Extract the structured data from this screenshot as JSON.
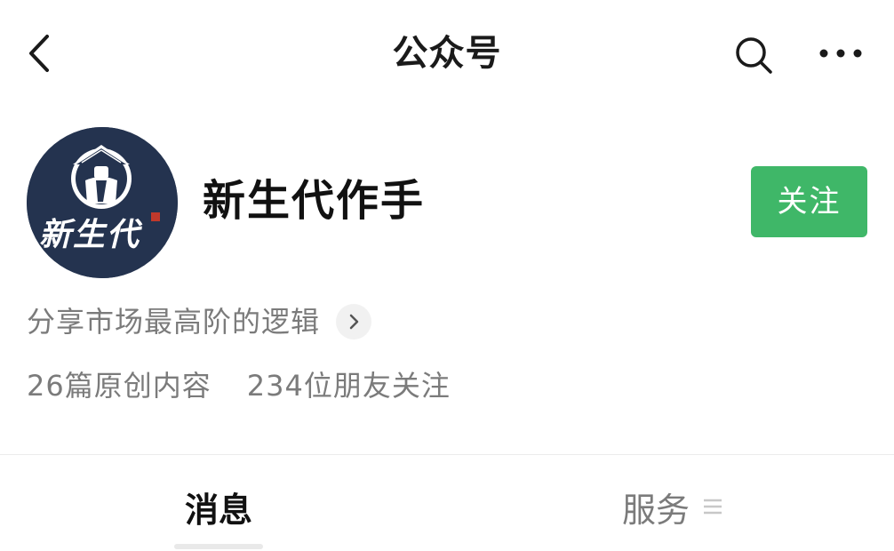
{
  "navbar": {
    "title": "公众号",
    "back_icon": "chevron-left-icon",
    "search_icon": "search-icon",
    "more_icon": "more-dots-icon"
  },
  "profile": {
    "name": "新生代作手",
    "avatar_text": "新生代",
    "follow_label": "关注",
    "intro": "分享市场最高阶的逻辑",
    "stats": {
      "articles": "26篇原创内容",
      "followers": "234位朋友关注"
    }
  },
  "tabs": {
    "messages": "消息",
    "services": "服务"
  },
  "colors": {
    "follow_button": "#3fb768",
    "avatar_bg": "#24334f",
    "secondary_text": "#7b7b7b"
  }
}
